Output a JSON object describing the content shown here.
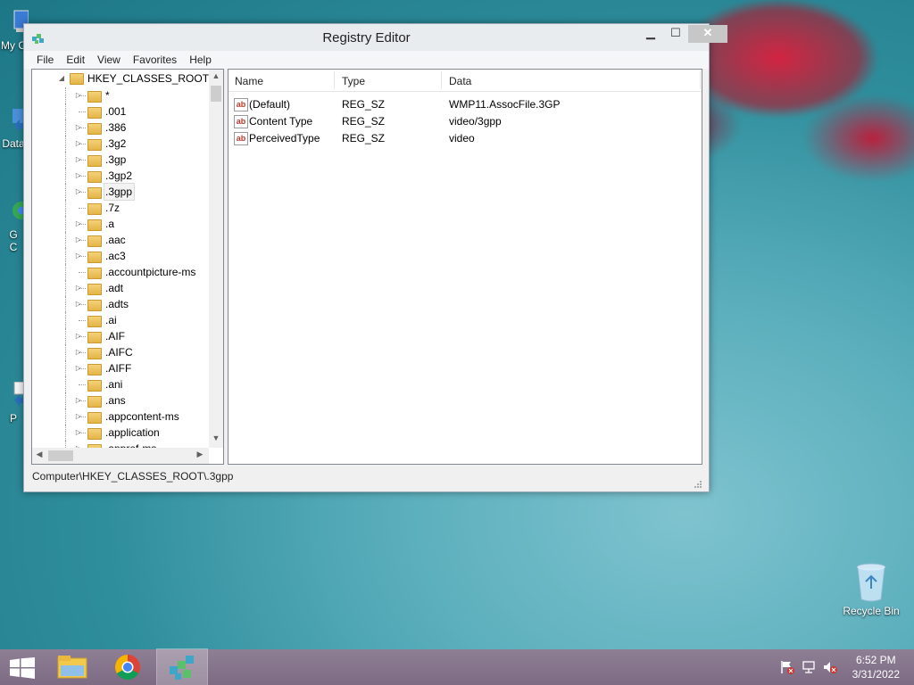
{
  "window": {
    "title": "Registry Editor",
    "controls": {
      "minimize": "▁",
      "maximize": "☐",
      "close": "✕"
    }
  },
  "menu": [
    "File",
    "Edit",
    "View",
    "Favorites",
    "Help"
  ],
  "tree": {
    "root": "HKEY_CLASSES_ROOT",
    "items": [
      {
        "label": "*",
        "expandable": true
      },
      {
        "label": ".001",
        "expandable": false
      },
      {
        "label": ".386",
        "expandable": true
      },
      {
        "label": ".3g2",
        "expandable": true
      },
      {
        "label": ".3gp",
        "expandable": true
      },
      {
        "label": ".3gp2",
        "expandable": true
      },
      {
        "label": ".3gpp",
        "expandable": true,
        "selected": true
      },
      {
        "label": ".7z",
        "expandable": false
      },
      {
        "label": ".a",
        "expandable": true
      },
      {
        "label": ".aac",
        "expandable": true
      },
      {
        "label": ".ac3",
        "expandable": true
      },
      {
        "label": ".accountpicture-ms",
        "expandable": false
      },
      {
        "label": ".adt",
        "expandable": true
      },
      {
        "label": ".adts",
        "expandable": true
      },
      {
        "label": ".ai",
        "expandable": false
      },
      {
        "label": ".AIF",
        "expandable": true
      },
      {
        "label": ".AIFC",
        "expandable": true
      },
      {
        "label": ".AIFF",
        "expandable": true
      },
      {
        "label": ".ani",
        "expandable": false
      },
      {
        "label": ".ans",
        "expandable": true
      },
      {
        "label": ".appcontent-ms",
        "expandable": true
      },
      {
        "label": ".application",
        "expandable": true
      },
      {
        "label": ".appref-ms",
        "expandable": true
      }
    ]
  },
  "list": {
    "columns": [
      "Name",
      "Type",
      "Data"
    ],
    "rows": [
      {
        "name": "(Default)",
        "type": "REG_SZ",
        "data": "WMP11.AssocFile.3GP"
      },
      {
        "name": "Content Type",
        "type": "REG_SZ",
        "data": "video/3gpp"
      },
      {
        "name": "PerceivedType",
        "type": "REG_SZ",
        "data": "video"
      }
    ]
  },
  "status": {
    "path": "Computer\\HKEY_CLASSES_ROOT\\.3gpp"
  },
  "desktop": {
    "icons": [
      {
        "label": "My C",
        "name": "my-computer"
      },
      {
        "label": "Data",
        "name": "data-shortcut"
      },
      {
        "label": "G\nC",
        "name": "chrome-shortcut"
      },
      {
        "label": "P",
        "name": "program-shortcut"
      }
    ],
    "recycle_bin": "Recycle Bin"
  },
  "taskbar": {
    "time": "6:52 PM",
    "date": "3/31/2022"
  },
  "colors": {
    "accent": "#7c6b83",
    "close_button": "#c7c7c7"
  }
}
